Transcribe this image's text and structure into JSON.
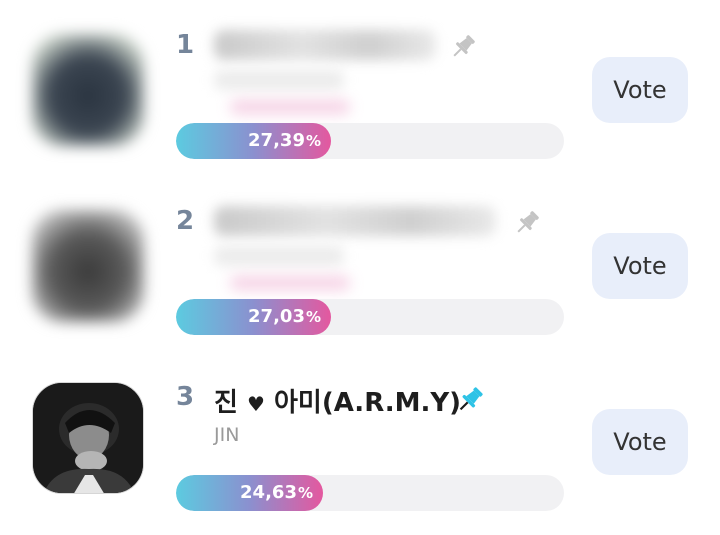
{
  "colors": {
    "bar_gradient_start": "#5ccbe0",
    "bar_gradient_end": "#e4589f",
    "rank_color": "#75859a",
    "vote_button_bg": "#e8eefa",
    "pin_active": "#2ec3e6",
    "pin_inactive": "#c4c4c4"
  },
  "ranking": [
    {
      "rank": "1",
      "name": "",
      "subname": "",
      "obscured": true,
      "pinned": false,
      "pin_icon": "pin-icon",
      "percent_value": "27,39",
      "percent_symbol": "%",
      "share": 0.4,
      "vote_label": "Vote"
    },
    {
      "rank": "2",
      "name": "",
      "subname": "",
      "obscured": true,
      "pinned": false,
      "pin_icon": "pin-icon",
      "percent_value": "27,03",
      "percent_symbol": "%",
      "share": 0.4,
      "vote_label": "Vote"
    },
    {
      "rank": "3",
      "name_part1": "진",
      "heart": "♥",
      "name_part2": "아미(A.R.M.Y)",
      "subname": "JIN",
      "obscured": false,
      "pinned": true,
      "pin_icon": "pin-icon",
      "percent_value": "24,63",
      "percent_symbol": "%",
      "share": 0.38,
      "vote_label": "Vote"
    }
  ]
}
